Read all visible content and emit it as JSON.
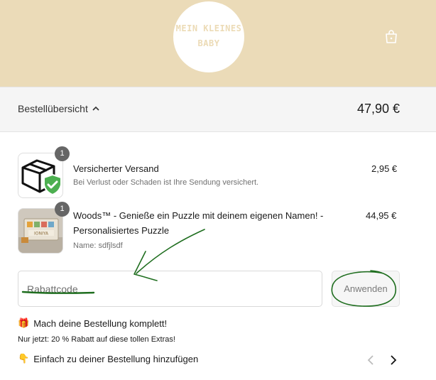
{
  "header": {
    "logo_line1": "MEIN KLEINES",
    "logo_line2": "BABY",
    "background": "#ebdbb8"
  },
  "summary": {
    "toggle_label": "Bestellübersicht",
    "total": "47,90 €"
  },
  "items": [
    {
      "quantity": "1",
      "title": "Versicherter Versand",
      "subtitle": "Bei Verlust oder Schaden ist Ihre Sendung versichert.",
      "price": "2,95 €",
      "icon": "shipping-box-shield-icon"
    },
    {
      "quantity": "1",
      "title_line1": "Woods™ - Genieße ein Puzzle mit deinem eigenen Namen! -",
      "title_line2": "Personalisiertes Puzzle",
      "subtitle": "Name: sdfjlsdf",
      "price": "44,95 €"
    }
  ],
  "discount": {
    "placeholder": "Rabattcode",
    "apply_label": "Anwenden"
  },
  "upsell": {
    "title_emoji": "🎁",
    "title": "Mach deine Bestellung komplett!",
    "subtitle": "Nur jetzt: 20 % Rabatt auf diese tollen Extras!",
    "add_emoji": "👇",
    "add_label": "Einfach zu deiner Bestellung hinzufügen"
  },
  "annotation_color": "#1f6e1f"
}
